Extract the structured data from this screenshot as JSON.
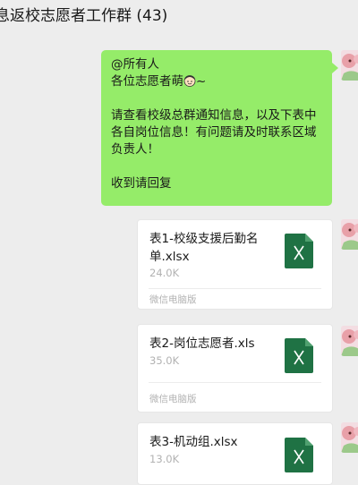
{
  "header": {
    "title": "息返校志愿者工作群 (43)"
  },
  "message": {
    "lines": [
      "@所有人",
      "各位志愿者萌",
      "",
      "请查看校级总群通知信息，以及下表中",
      "各自岗位信息！有问题请及时联系区域",
      "负责人！",
      "",
      "收到请回复"
    ],
    "line1": "@所有人",
    "line2_prefix": "各位志愿者萌",
    "line2_suffix": "~",
    "line3": "请查看校级总群通知信息，以及下表中",
    "line4": "各自岗位信息！有问题请及时联系区域",
    "line5": "负责人！",
    "line6": "收到请回复",
    "emoji_icon": "smiling-girl-face-icon",
    "bubble_color": "#95ec69"
  },
  "files": [
    {
      "name_line1": "表1-校级支援后勤名",
      "name_line2": "单.xlsx",
      "size": "24.0K",
      "source": "微信电脑版",
      "icon": "excel-file-icon"
    },
    {
      "name_line1": "表2-岗位志愿者.xls",
      "name_line2": "",
      "size": "35.0K",
      "source": "微信电脑版",
      "icon": "excel-file-icon"
    },
    {
      "name_line1": "表3-机动组.xlsx",
      "name_line2": "",
      "size": "13.0K",
      "source": "",
      "icon": "excel-file-icon"
    }
  ],
  "colors": {
    "background": "#ededed",
    "excel_green": "#1f7244",
    "avatar_pink": "#e8a0a8"
  }
}
